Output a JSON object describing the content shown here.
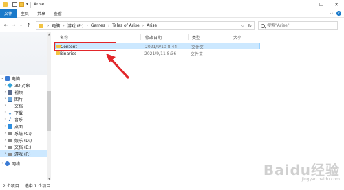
{
  "window": {
    "title": "Arise",
    "minimize": "—",
    "maximize": "☐",
    "close": "✕"
  },
  "ribbon": {
    "tabs": [
      "文件",
      "主页",
      "共享",
      "查看"
    ],
    "expand": "⌵",
    "help": "?"
  },
  "nav": {
    "back": "←",
    "forward": "→",
    "recent": "⌵",
    "up": "↑"
  },
  "address": {
    "crumbs": [
      "电脑",
      "游戏 (F:)",
      "Games",
      "Tales of Arise",
      "Arise"
    ],
    "separator": "›",
    "dropdown": "⌵",
    "refresh": "↻"
  },
  "search": {
    "placeholder": "搜索\"Arise\""
  },
  "sidebar": {
    "items": [
      {
        "label": "电脑",
        "icon": "computer-icon",
        "expanded": true
      },
      {
        "label": "3D 对象",
        "icon": "3d-objects-icon"
      },
      {
        "label": "视频",
        "icon": "video-icon"
      },
      {
        "label": "图片",
        "icon": "picture-icon"
      },
      {
        "label": "文档",
        "icon": "document-icon"
      },
      {
        "label": "下载",
        "icon": "download-icon"
      },
      {
        "label": "音乐",
        "icon": "music-icon"
      },
      {
        "label": "桌面",
        "icon": "desktop-icon"
      },
      {
        "label": "系统 (C:)",
        "icon": "drive-icon"
      },
      {
        "label": "娱乐 (D:)",
        "icon": "drive-icon"
      },
      {
        "label": "文档 (E:)",
        "icon": "drive-icon"
      },
      {
        "label": "游戏 (F:)",
        "icon": "drive-icon",
        "selected": true
      },
      {
        "label": "网络",
        "icon": "network-icon"
      }
    ]
  },
  "columns": {
    "name": "名称",
    "date": "修改日期",
    "type": "类型",
    "size": "大小"
  },
  "files": [
    {
      "name": "Content",
      "date": "2021/9/10 8:44",
      "type": "文件夹",
      "selected": true
    },
    {
      "name": "Binaries",
      "date": "2021/9/11 8:36",
      "type": "文件夹"
    }
  ],
  "status": {
    "count": "2 个项目",
    "selection": "选中 1 个项目"
  },
  "watermark": {
    "text": "Baidu经验",
    "url": "jingyan.baidu.com"
  },
  "colors": {
    "accent": "#1979ca",
    "folder": "#f3c443",
    "selection": "#cce8ff",
    "annotation": "#e2262a"
  }
}
